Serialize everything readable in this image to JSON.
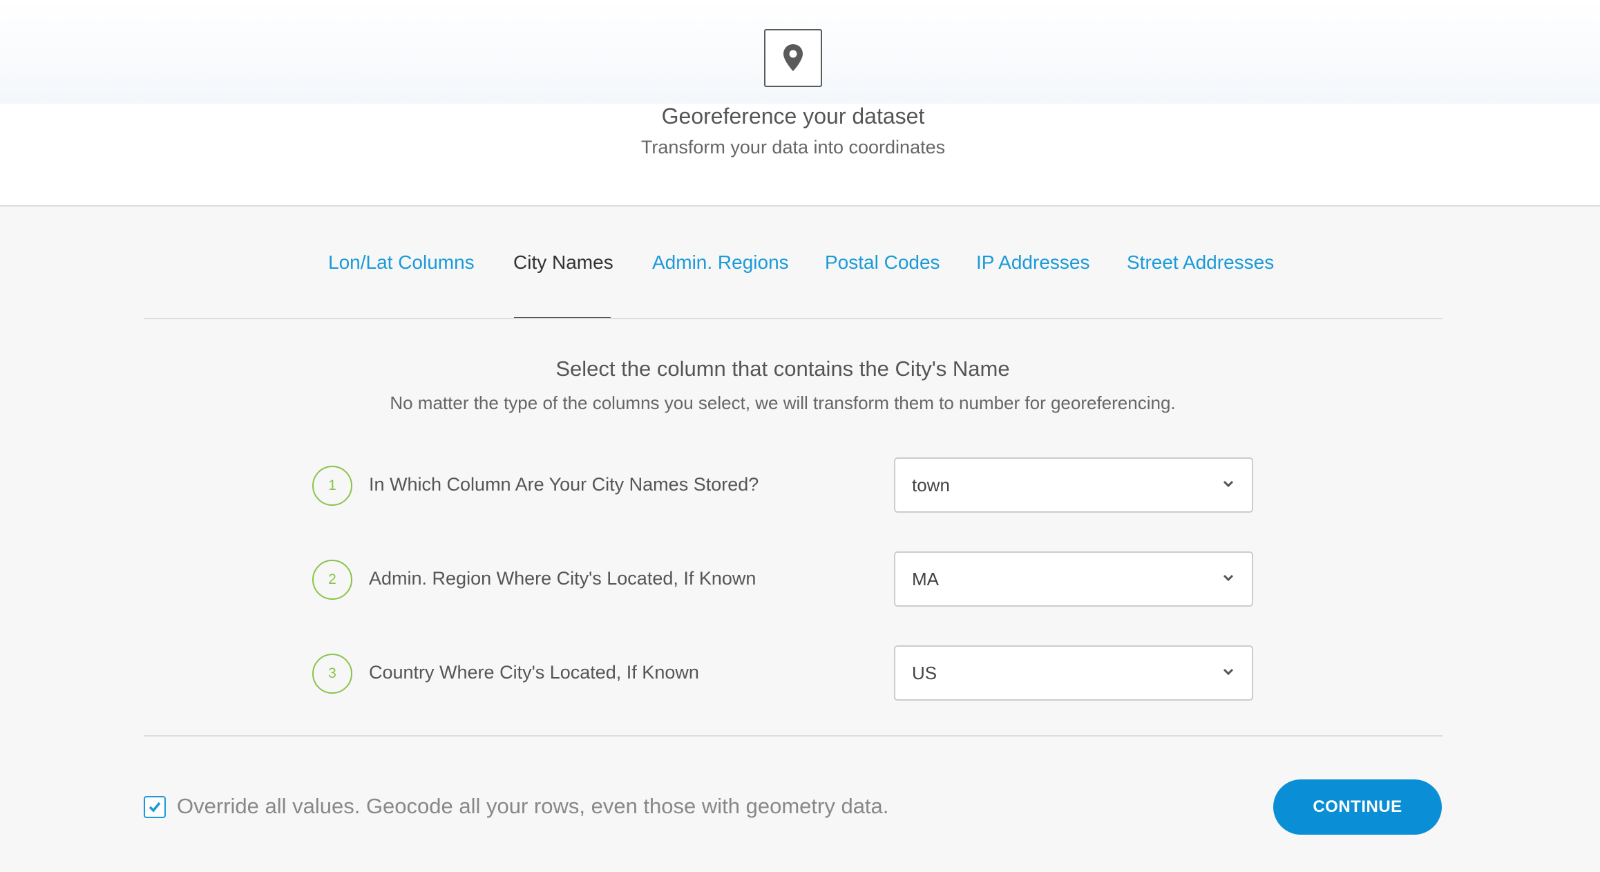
{
  "header": {
    "title": "Georeference your dataset",
    "subtitle": "Transform your data into coordinates",
    "icon": "map-pin-icon"
  },
  "tabs": [
    {
      "label": "Lon/Lat Columns",
      "active": false
    },
    {
      "label": "City Names",
      "active": true
    },
    {
      "label": "Admin. Regions",
      "active": false
    },
    {
      "label": "Postal Codes",
      "active": false
    },
    {
      "label": "IP Addresses",
      "active": false
    },
    {
      "label": "Street Addresses",
      "active": false
    }
  ],
  "section": {
    "title": "Select the column that contains the City's Name",
    "subtitle": "No matter the type of the columns you select, we will transform them to number for georeferencing."
  },
  "steps": [
    {
      "number": "1",
      "label": "In Which Column Are Your City Names Stored?",
      "value": "town"
    },
    {
      "number": "2",
      "label": "Admin. Region Where City's Located, If Known",
      "value": "MA"
    },
    {
      "number": "3",
      "label": "Country Where City's Located, If Known",
      "value": "US"
    }
  ],
  "override": {
    "checked": true,
    "label": "Override all values. Geocode all your rows, even those with geometry data."
  },
  "continue_label": "CONTINUE",
  "colors": {
    "accent": "#1a9ad8",
    "button": "#0a8fd6",
    "step": "#8bc34a"
  }
}
